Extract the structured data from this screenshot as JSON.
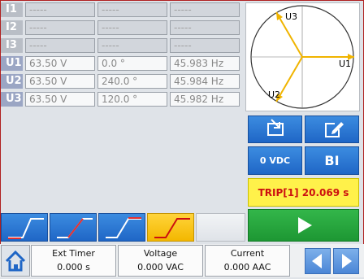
{
  "channels": [
    {
      "label": "I1",
      "c1": "-----",
      "c2": "-----",
      "c3": "-----",
      "active": false
    },
    {
      "label": "I2",
      "c1": "-----",
      "c2": "-----",
      "c3": "-----",
      "active": false
    },
    {
      "label": "I3",
      "c1": "-----",
      "c2": "-----",
      "c3": "-----",
      "active": false
    },
    {
      "label": "U1",
      "c1": "63.50 V",
      "c2": "0.0 °",
      "c3": "45.983 Hz",
      "active": true
    },
    {
      "label": "U2",
      "c1": "63.50 V",
      "c2": "240.0 °",
      "c3": "45.984 Hz",
      "active": true
    },
    {
      "label": "U3",
      "c1": "63.50 V",
      "c2": "120.0 °",
      "c3": "45.982 Hz",
      "active": true
    }
  ],
  "vector": {
    "labels": {
      "u1": "U1",
      "u2": "U2",
      "u3": "U3"
    },
    "color": "#f0b400"
  },
  "buttons": {
    "vdc": "0 VDC",
    "bi": "BI",
    "trip": "TRIP[1] 20.069 s"
  },
  "meters": [
    {
      "title": "Ext Timer",
      "value": "0.000 s"
    },
    {
      "title": "Voltage",
      "value": "0.000 VAC"
    },
    {
      "title": "Current",
      "value": "0.000 AAC"
    }
  ],
  "icons": {
    "export": "export-icon",
    "edit": "edit-icon",
    "play": "play-icon",
    "home": "home-icon",
    "prev": "arrow-left-icon",
    "next": "arrow-right-icon"
  },
  "colors": {
    "blue": "#1f66c6",
    "green": "#1d9733",
    "yellow": "#fff14a",
    "trip_text": "#cc1010",
    "ramp_active": "#f3b700"
  }
}
